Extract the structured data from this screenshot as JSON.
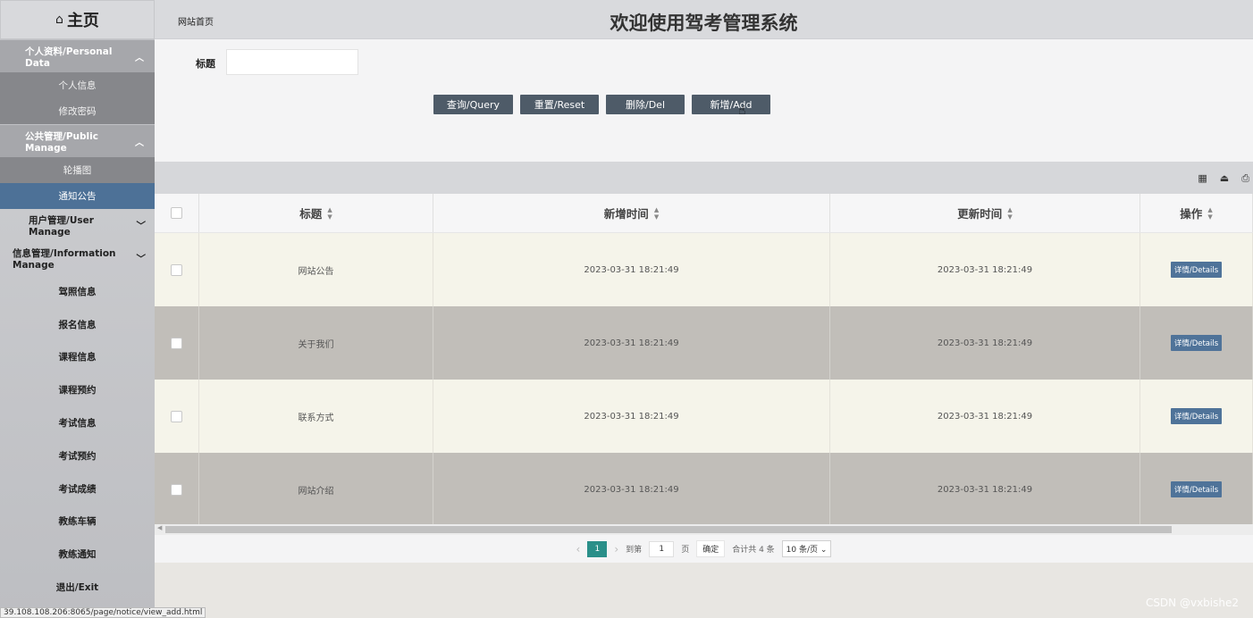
{
  "sidebar": {
    "home_label": "主页",
    "group1_label": "个人资料/Personal Data",
    "group1_items": [
      "个人信息",
      "修改密码"
    ],
    "group2_label": "公共管理/Public Manage",
    "group2_items": [
      "轮播图",
      "通知公告"
    ],
    "group3_label": "用户管理/User Manage",
    "group4_label": "信息管理/Information Manage",
    "items": [
      "驾照信息",
      "报名信息",
      "课程信息",
      "课程预约",
      "考试信息",
      "考试预约",
      "考试成绩",
      "教练车辆",
      "教练通知",
      "退出/Exit"
    ]
  },
  "header": {
    "breadcrumb": "网站首页",
    "title": "欢迎使用驾考管理系统"
  },
  "search": {
    "title_label": "标题",
    "title_value": "",
    "query_label": "查询/Query",
    "reset_label": "重置/Reset",
    "del_label": "删除/Del",
    "add_label": "新增/Add"
  },
  "table": {
    "headers": [
      "标题",
      "新增时间",
      "更新时间",
      "操作"
    ],
    "rows": [
      {
        "title": "网站公告",
        "created": "2023-03-31 18:21:49",
        "updated": "2023-03-31 18:21:49",
        "action": "详情/Details"
      },
      {
        "title": "关于我们",
        "created": "2023-03-31 18:21:49",
        "updated": "2023-03-31 18:21:49",
        "action": "详情/Details"
      },
      {
        "title": "联系方式",
        "created": "2023-03-31 18:21:49",
        "updated": "2023-03-31 18:21:49",
        "action": "详情/Details"
      },
      {
        "title": "网站介绍",
        "created": "2023-03-31 18:21:49",
        "updated": "2023-03-31 18:21:49",
        "action": "详情/Details"
      }
    ]
  },
  "pager": {
    "current": "1",
    "goto_label": "到第",
    "goto_value": "1",
    "page_label": "页",
    "confirm_label": "确定",
    "total_label": "合计共 4 条",
    "page_size": "10 条/页"
  },
  "status_url": "39.108.108.206:8065/page/notice/view_add.html",
  "watermark": "CSDN @vxbishe2"
}
